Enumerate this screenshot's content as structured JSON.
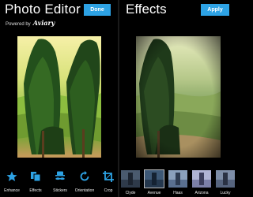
{
  "editor": {
    "title": "Photo Editor",
    "done_label": "Done",
    "powered_by": "Powered by",
    "brand": "Aviary",
    "tools": [
      {
        "label": "Enhance",
        "icon": "star-icon"
      },
      {
        "label": "Effects",
        "icon": "effects-icon"
      },
      {
        "label": "Stickers",
        "icon": "mustache-icon"
      },
      {
        "label": "Orientation",
        "icon": "rotate-icon"
      },
      {
        "label": "Crop",
        "icon": "crop-icon"
      }
    ]
  },
  "effects": {
    "title": "Effects",
    "apply_label": "Apply",
    "filters": [
      {
        "label": "Clyde",
        "selected": false
      },
      {
        "label": "Avenue",
        "selected": true
      },
      {
        "label": "Haas",
        "selected": false
      },
      {
        "label": "Arizona",
        "selected": false
      },
      {
        "label": "Lucky",
        "selected": false
      }
    ]
  },
  "colors": {
    "accent": "#2da2e4",
    "background": "#000000"
  }
}
